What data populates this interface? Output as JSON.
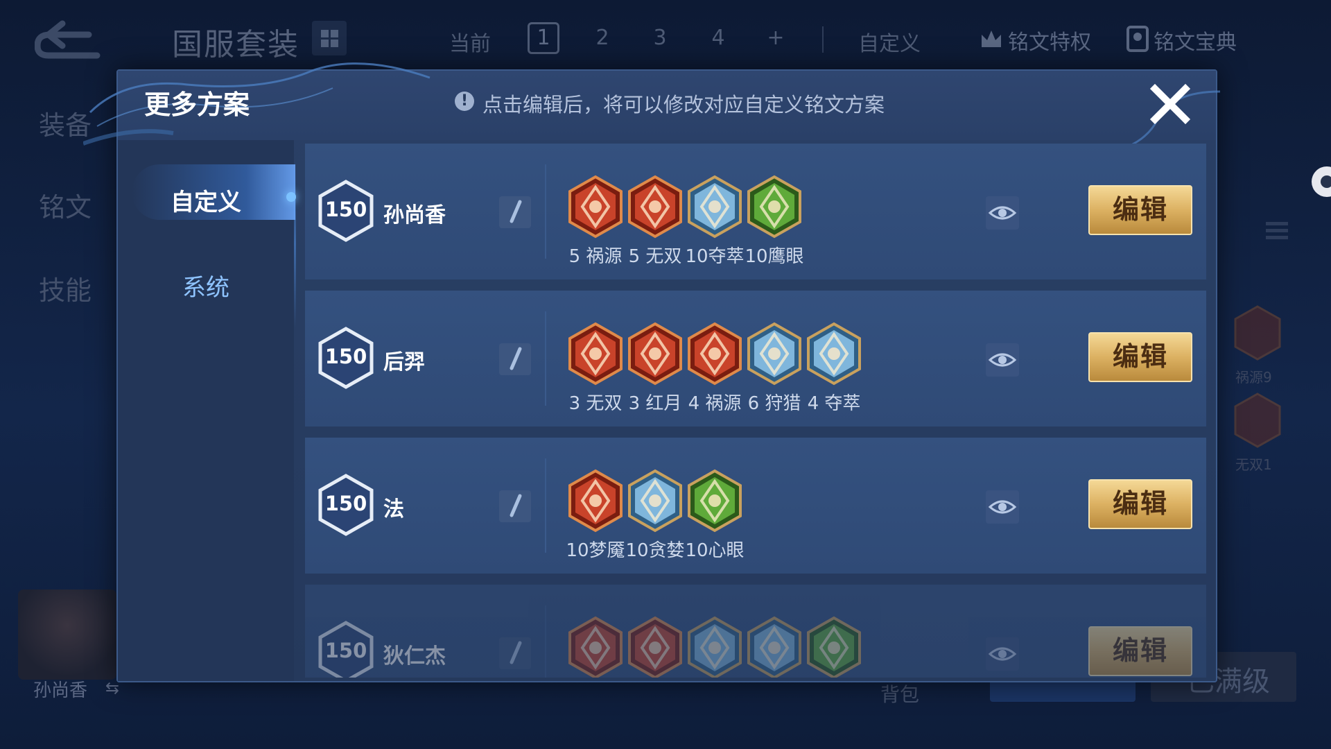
{
  "background": {
    "set_title": "国服套装",
    "current_label": "当前",
    "pages": [
      "1",
      "2",
      "3",
      "4",
      "+"
    ],
    "active_page": "1",
    "custom_label": "自定义",
    "privilege_label": "铭文特权",
    "handbook_label": "铭文宝典",
    "side_tabs": [
      "装备",
      "铭文",
      "技能"
    ],
    "hero_name": "孙尚香",
    "bag_label": "背包",
    "max_level_label": "已满级",
    "side_runes": [
      "祸源9",
      "无双1"
    ]
  },
  "modal": {
    "title": "更多方案",
    "notice": "点击编辑后，将可以修改对应自定义铭文方案",
    "close_icon": "close-icon",
    "nav": {
      "active": "自定义",
      "other": "系统"
    },
    "plans": [
      {
        "level": "150",
        "name": "孙尚香",
        "edit_label": "编辑",
        "runes": [
          {
            "label": "5 祸源",
            "kind": "red",
            "icon": "huoyuan"
          },
          {
            "label": "5 无双",
            "kind": "red",
            "icon": "wushuang"
          },
          {
            "label": "10夺萃",
            "kind": "blue",
            "icon": "duocui"
          },
          {
            "label": "10鹰眼",
            "kind": "green",
            "icon": "yingyan"
          }
        ]
      },
      {
        "level": "150",
        "name": "后羿",
        "edit_label": "编辑",
        "runes": [
          {
            "label": "3 无双",
            "kind": "red",
            "icon": "wushuang"
          },
          {
            "label": "3 红月",
            "kind": "red",
            "icon": "hongyue"
          },
          {
            "label": "4 祸源",
            "kind": "red",
            "icon": "huoyuan"
          },
          {
            "label": "6 狩猎",
            "kind": "blue",
            "icon": "shoulie"
          },
          {
            "label": "4 夺萃",
            "kind": "blue",
            "icon": "duocui"
          }
        ]
      },
      {
        "level": "150",
        "name": "法",
        "edit_label": "编辑",
        "runes": [
          {
            "label": "10梦魇",
            "kind": "red",
            "icon": "mengyan"
          },
          {
            "label": "10贪婪",
            "kind": "blue",
            "icon": "tanlan"
          },
          {
            "label": "10心眼",
            "kind": "green",
            "icon": "xinyan"
          }
        ]
      },
      {
        "level": "150",
        "name": "狄仁杰",
        "edit_label": "编辑",
        "runes": [
          {
            "label": "",
            "kind": "red",
            "icon": "huoyuan"
          },
          {
            "label": "",
            "kind": "red",
            "icon": "wushuang"
          },
          {
            "label": "",
            "kind": "blue",
            "icon": "duocui"
          },
          {
            "label": "",
            "kind": "blue",
            "icon": "shoulie"
          },
          {
            "label": "",
            "kind": "green",
            "icon": "yingyan"
          }
        ]
      }
    ]
  },
  "colors": {
    "red_rune": "#c9432a",
    "blue_rune": "#7fb6dc",
    "green_rune": "#5faa3a",
    "gold_button": "#dcb162",
    "panel": "#2a4066"
  }
}
